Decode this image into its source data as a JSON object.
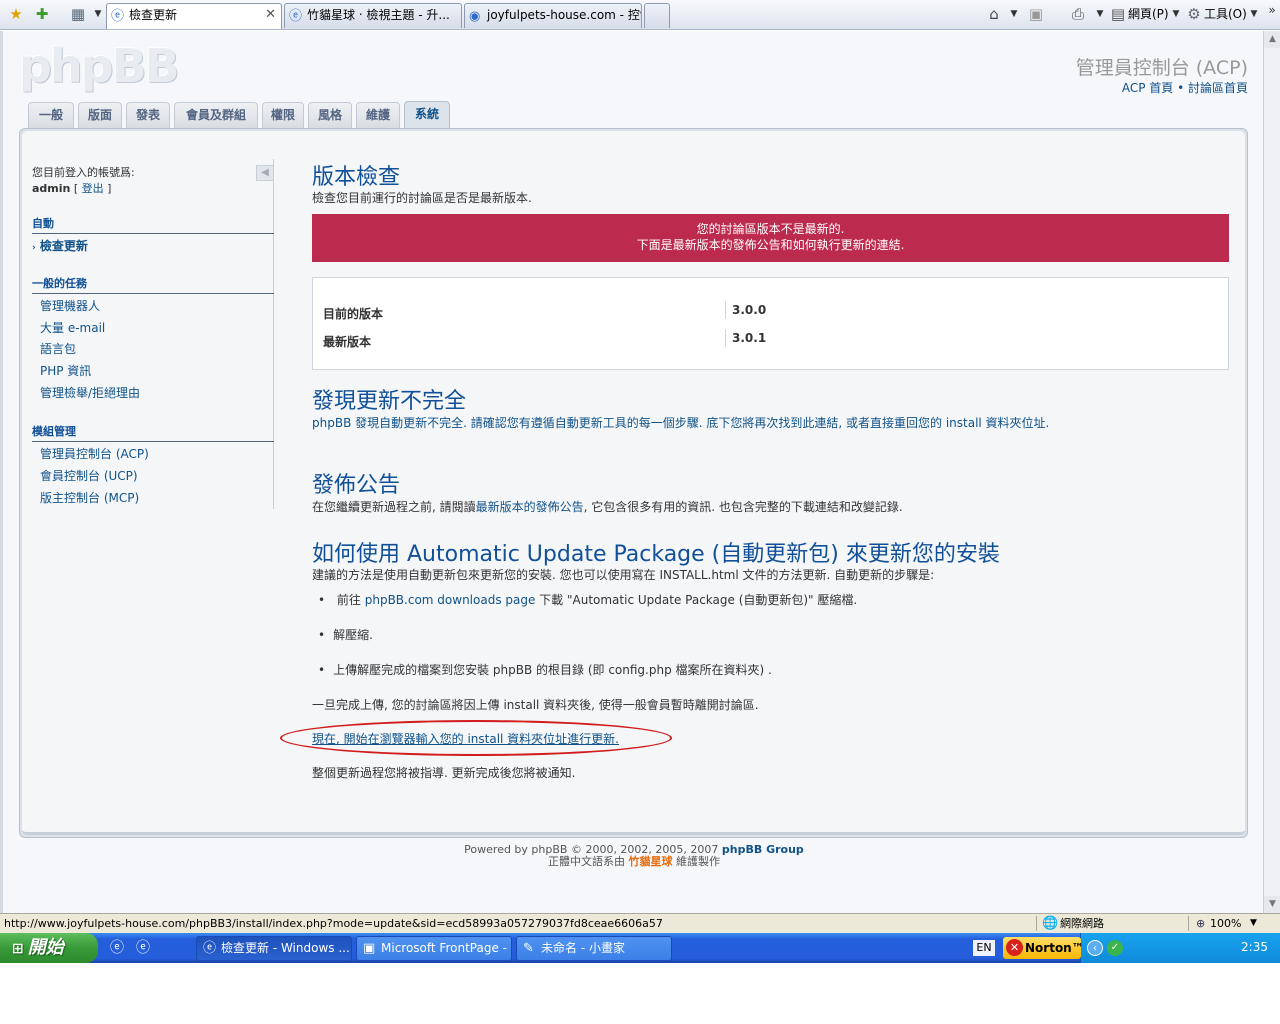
{
  "browser": {
    "tabs": [
      {
        "label": "檢查更新",
        "active": true
      },
      {
        "label": "竹貓星球 ‧ 檢視主題 - 升..."
      },
      {
        "label": "joyfulpets-house.com - 控制..."
      }
    ],
    "commands": {
      "page": "網頁(P)",
      "tools": "工具(O)"
    }
  },
  "header": {
    "logo": "phpBB",
    "acp_title": "管理員控制台 (ACP)",
    "link_acp_home": "ACP 首頁",
    "link_sep": " • ",
    "link_board_home": "討論區首頁"
  },
  "nav_tabs": [
    "一般",
    "版面",
    "發表",
    "會員及群組",
    "權限",
    "風格",
    "維護",
    "系統"
  ],
  "sidebar": {
    "login_label": "您目前登入的帳號爲:",
    "username": "admin",
    "logout_open": " [ ",
    "logout": "登出",
    "logout_close": " ]",
    "sections": [
      {
        "title": "自動",
        "items": [
          "檢查更新"
        ]
      },
      {
        "title": "一般的任務",
        "items": [
          "管理機器人",
          "大量 e-mail",
          "語言包",
          "PHP 資訊",
          "管理檢舉/拒絕理由"
        ]
      },
      {
        "title": "模組管理",
        "items": [
          "管理員控制台 (ACP)",
          "會員控制台 (UCP)",
          "版主控制台 (MCP)"
        ]
      }
    ]
  },
  "content": {
    "title": "版本檢查",
    "subtitle": "檢查您目前運行的討論區是否是最新版本.",
    "error_line1": "您的討論區版本不是最新的.",
    "error_line2": "下面是最新版本的發佈公告和如何執行更新的連結.",
    "versions": [
      {
        "label": "目前的版本",
        "value": "3.0.0"
      },
      {
        "label": "最新版本",
        "value": "3.0.1"
      }
    ],
    "incomplete_title": "發現更新不完全",
    "incomplete_text": "phpBB 發現自動更新不完全. 請確認您有遵循自動更新工具的每一個步驟. 底下您將再次找到此連結, 或者直接重回您的 install 資料夾位址.",
    "announce_title": "發佈公告",
    "announce_pre": "在您繼續更新過程之前, 請閱讀",
    "announce_link": "最新版本的發佈公告",
    "announce_post": ", 它包含很多有用的資訊. 也包含完整的下載連結和改變記錄.",
    "howto_title": "如何使用 Automatic Update Package (自動更新包) 來更新您的安裝",
    "howto_intro": "建議的方法是使用自動更新包來更新您的安裝. 您也可以使用寫在 INSTALL.html 文件的方法更新. 自動更新的步驟是:",
    "step1_pre": "前往 ",
    "step1_link": "phpBB.com downloads page",
    "step1_post": " 下載 \"Automatic Update Package (自動更新包)\" 壓縮檔.",
    "step2": "解壓縮.",
    "step3": "上傳解壓完成的檔案到您安裝 phpBB 的根目錄 (即 config.php 檔案所在資料夾) .",
    "after_upload": "一旦完成上傳, 您的討論區將因上傳 install 資料夾後, 使得一般會員暫時離開討論區.",
    "update_link": "現在, 開始在瀏覽器輸入您的 install 資料夾位址進行更新.",
    "guided": "整個更新過程您將被指導. 更新完成後您將被通知."
  },
  "footer": {
    "powered_pre": "Powered by phpBB © 2000, 2002, 2005, 2007 ",
    "powered_link": "phpBB Group",
    "trans_pre": "正體中文語系由 ",
    "trans_brand": "竹貓星球",
    "trans_post": " 維護製作"
  },
  "statusbar": {
    "url": "http://www.joyfulpets-house.com/phpBB3/install/index.php?mode=update&sid=ecd58993a057279037fd8ceae6606a57",
    "zone": "網際網路",
    "zoom": "100%"
  },
  "taskbar": {
    "start": "開始",
    "tasks": [
      "檢查更新 - Windows ...",
      "Microsoft FrontPage - ...",
      "未命名 - 小畫家"
    ],
    "lang": "EN",
    "norton": "Norton™",
    "clock": "2:35"
  },
  "colors": {
    "error_bg": "#bc2a4d",
    "link": "#105289",
    "heading": "#115098"
  }
}
